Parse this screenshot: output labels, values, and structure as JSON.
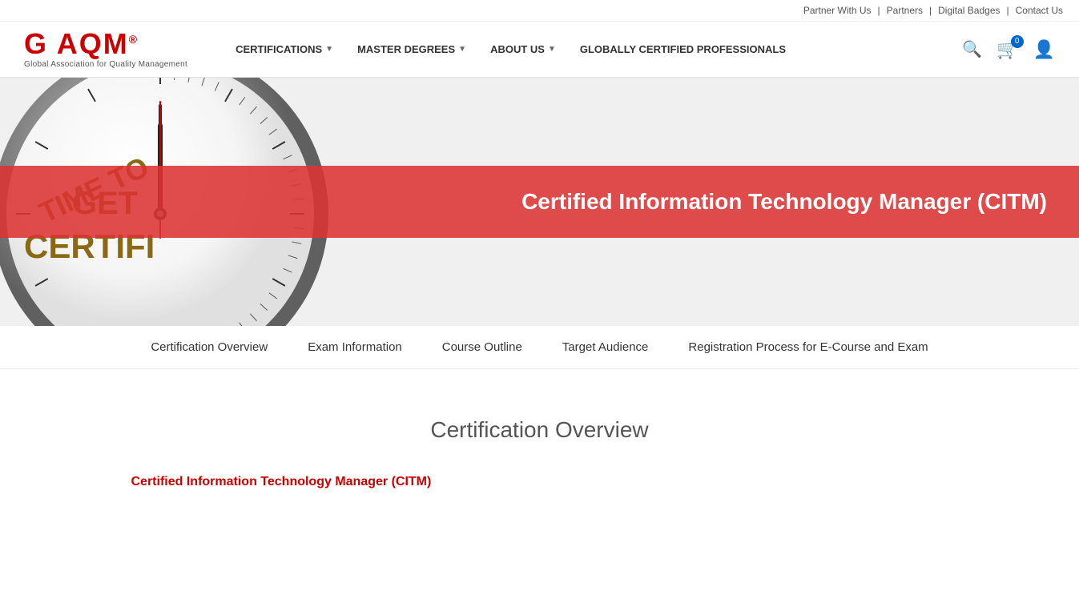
{
  "utility_bar": {
    "partner_with_us": "Partner With Us",
    "partners": "Partners",
    "digital_badges": "Digital Badges",
    "contact_us": "Contact Us"
  },
  "logo": {
    "text": "GAQM",
    "registered_mark": "®",
    "subtitle": "Global Association for Quality Management"
  },
  "nav": {
    "items": [
      {
        "label": "CERTIFICATIONS",
        "has_dropdown": true
      },
      {
        "label": "MASTER DEGREES",
        "has_dropdown": true
      },
      {
        "label": "ABOUT US",
        "has_dropdown": true
      },
      {
        "label": "GLOBALLY CERTIFIED PROFESSIONALS",
        "has_dropdown": false
      }
    ],
    "cart_count": "0"
  },
  "hero": {
    "clock_text_line1": "TIME TO GET",
    "clock_text_line2": "CERTIFIED",
    "title": "Certified Information Technology Manager (CITM)",
    "overlay_color": "#e04040"
  },
  "sub_nav": {
    "items": [
      {
        "label": "Certification Overview"
      },
      {
        "label": "Exam Information"
      },
      {
        "label": "Course Outline"
      },
      {
        "label": "Target Audience"
      },
      {
        "label": "Registration Process for E-Course and Exam"
      }
    ]
  },
  "content": {
    "section_title": "Certification Overview",
    "cert_link_label": "Certified Information Technology Manager (CITM)"
  }
}
